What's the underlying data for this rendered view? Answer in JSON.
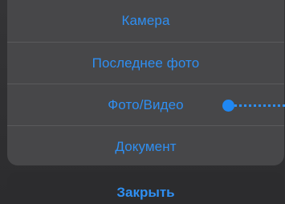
{
  "action_sheet": {
    "options": [
      {
        "label": "Камера"
      },
      {
        "label": "Последнее фото"
      },
      {
        "label": "Фото/Видео"
      },
      {
        "label": "Документ"
      }
    ],
    "cancel_label": "Закрыть"
  },
  "colors": {
    "accent": "#2f8ff2",
    "sheet_background": "#474749",
    "cancel_background": "#2c2c2e",
    "separator": "#5a5a5c"
  }
}
